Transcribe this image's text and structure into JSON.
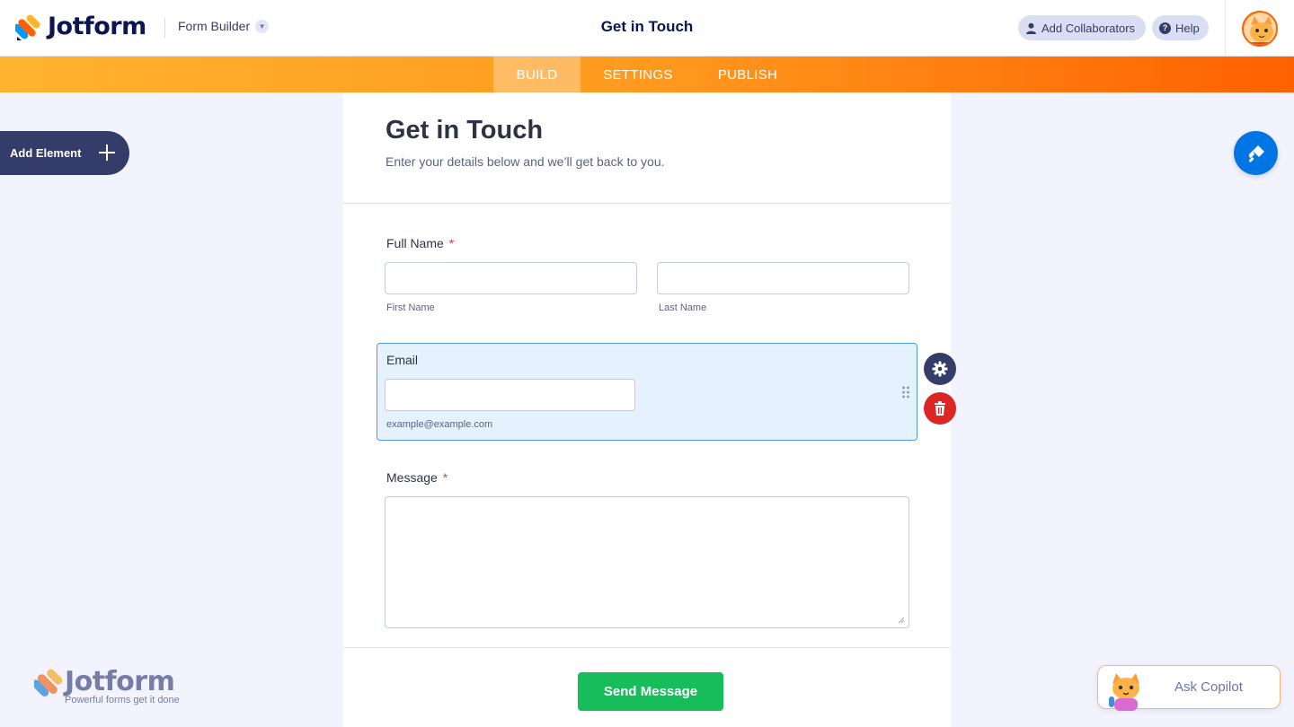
{
  "header": {
    "brand": "Jotform",
    "builder_label": "Form Builder",
    "title": "Get in Touch",
    "add_collaborators": "Add Collaborators",
    "help": "Help"
  },
  "nav": {
    "tabs": [
      {
        "label": "BUILD",
        "active": true
      },
      {
        "label": "SETTINGS",
        "active": false
      },
      {
        "label": "PUBLISH",
        "active": false
      }
    ]
  },
  "sidebar": {
    "add_element": "Add Element"
  },
  "form": {
    "title": "Get in Touch",
    "subtitle": "Enter your details below and we’ll get back to you.",
    "fields": {
      "full_name": {
        "label": "Full Name",
        "required": "*",
        "first_sublabel": "First Name",
        "last_sublabel": "Last Name"
      },
      "email": {
        "label": "Email",
        "sublabel": "example@example.com"
      },
      "message": {
        "label": "Message",
        "required": "*"
      }
    },
    "submit": "Send Message"
  },
  "watermark": {
    "brand": "Jotform",
    "tagline": "Powerful forms get it done"
  },
  "copilot": {
    "label": "Ask Copilot"
  },
  "colors": {
    "accent_orange": "#ff6100",
    "navy": "#0a1551",
    "submit_green": "#18bd5b",
    "paint_blue": "#0075e3",
    "delete_red": "#dc2626"
  }
}
